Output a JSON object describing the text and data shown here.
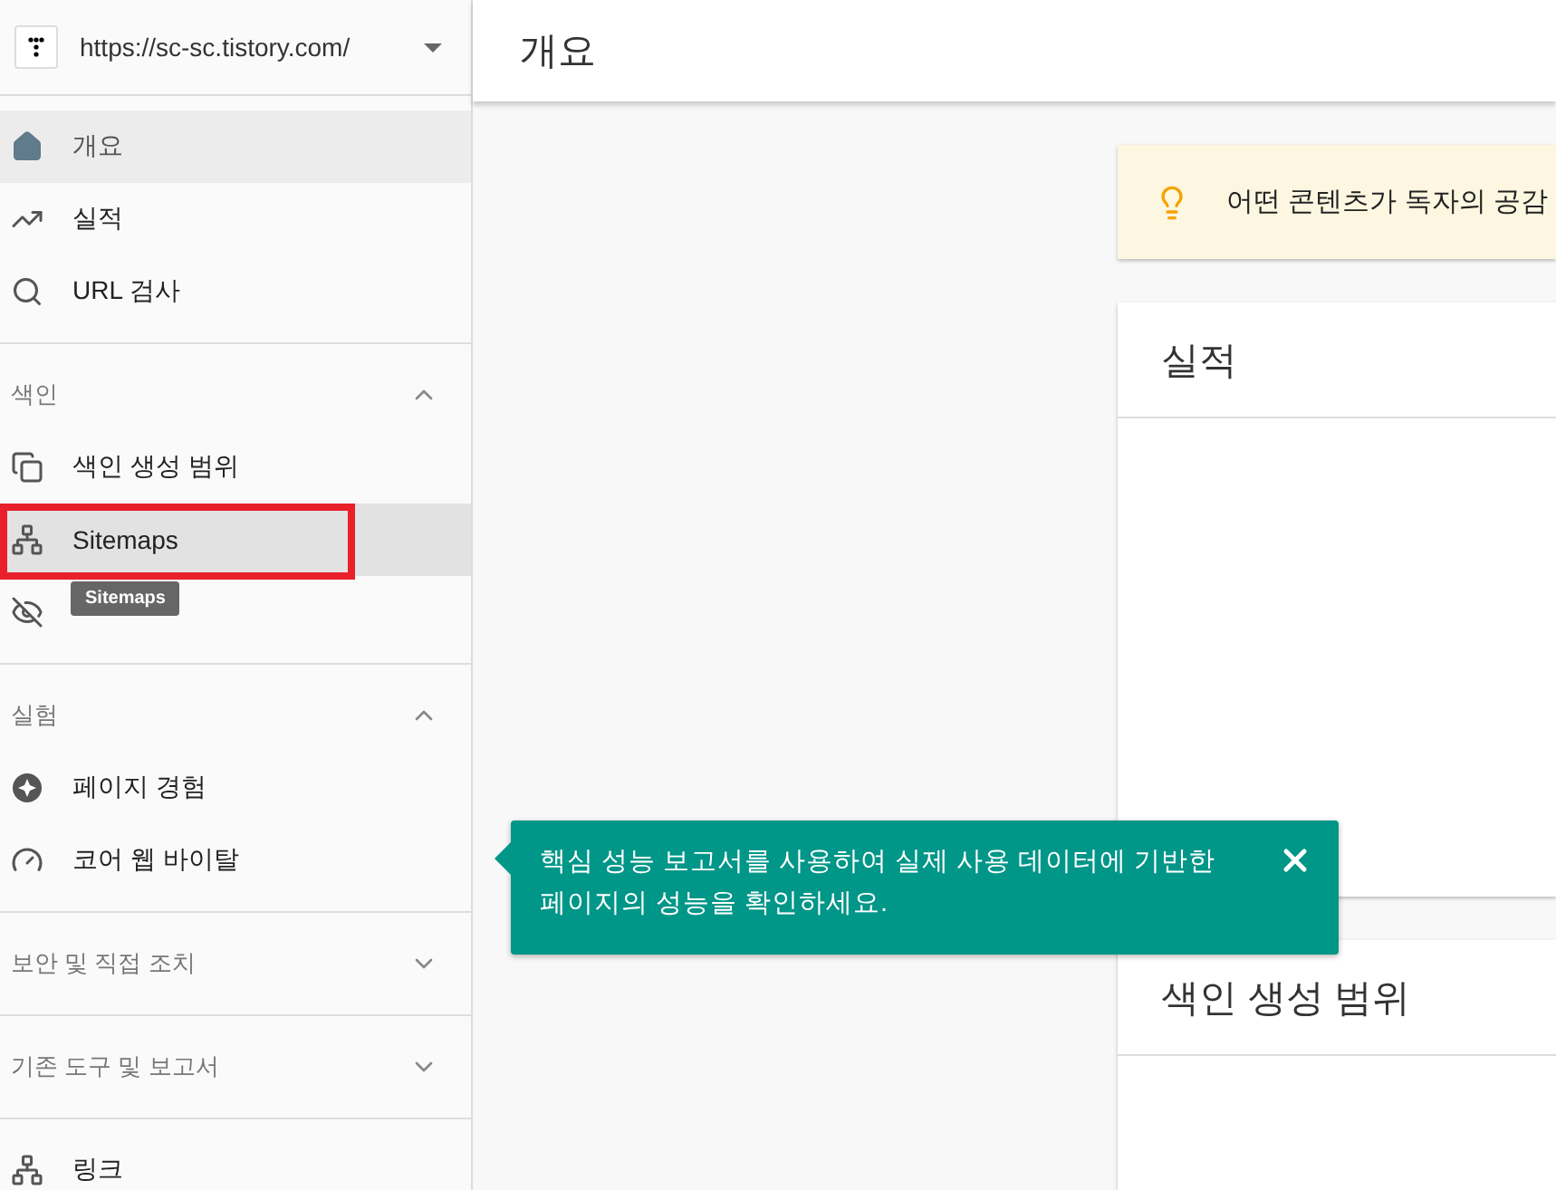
{
  "sidebar": {
    "property": {
      "url": "https://sc-sc.tistory.com/"
    },
    "groups": [
      {
        "items": [
          {
            "label": "개요",
            "selected": true,
            "hovered": false
          },
          {
            "label": "실적",
            "selected": false,
            "hovered": false
          },
          {
            "label": "URL 검사",
            "selected": false,
            "hovered": false
          }
        ]
      },
      {
        "title": "색인",
        "expanded": true,
        "items": [
          {
            "label": "색인 생성 범위",
            "selected": false,
            "hovered": false
          },
          {
            "label": "Sitemaps",
            "selected": false,
            "hovered": true,
            "annotated": true,
            "tooltip": "Sitemaps"
          },
          {
            "selected": false,
            "hovered": false
          }
        ]
      },
      {
        "title": "실험",
        "expanded": true,
        "items": [
          {
            "label": "페이지 경험",
            "selected": false,
            "hovered": false
          },
          {
            "label": "코어 웹 바이탈",
            "selected": false,
            "hovered": false
          }
        ]
      },
      {
        "title": "보안 및 직접 조치",
        "expanded": false
      },
      {
        "title": "기존 도구 및 보고서",
        "expanded": false
      },
      {
        "items": [
          {
            "label": "링크",
            "selected": false,
            "hovered": false
          }
        ]
      }
    ]
  },
  "header": {
    "title": "개요"
  },
  "banner": {
    "text": "어떤 콘텐츠가 독자의 공감"
  },
  "cards": [
    {
      "title": "실적"
    },
    {
      "title": "색인 생성 범위"
    }
  ],
  "callout": {
    "text": "핵심 성능 보고서를 사용하여 실제 사용 데이터에 기반한 페이지의 성능을 확인하세요."
  }
}
